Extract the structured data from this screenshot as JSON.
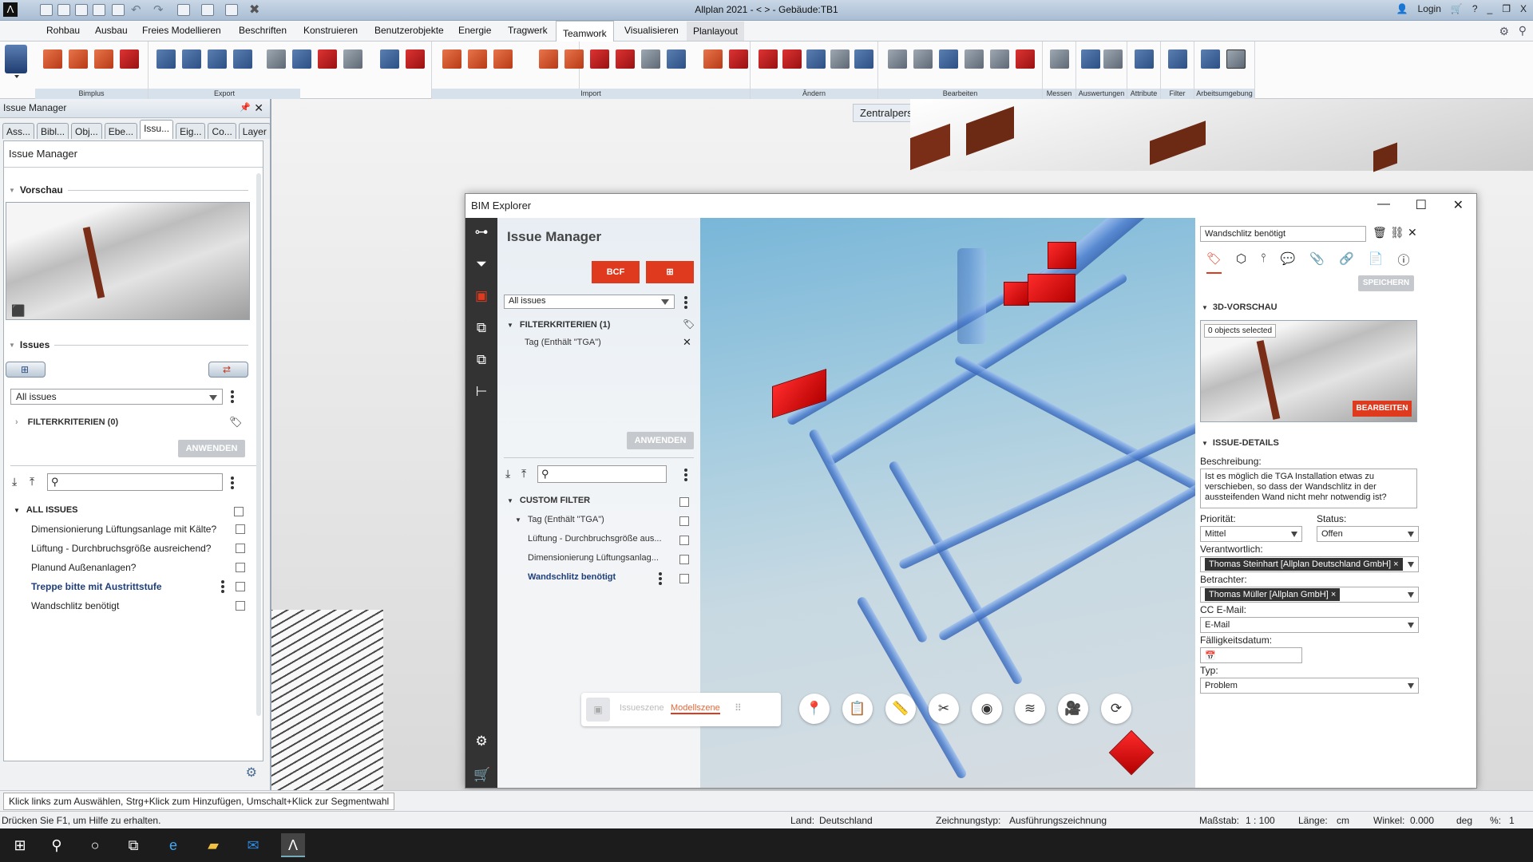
{
  "app": {
    "title": "Allplan 2021 - <    > - Gebäude:TB1",
    "login_label": "Login",
    "logo_glyph": "Λ"
  },
  "menu": {
    "tabs": [
      "Rohbau",
      "Ausbau",
      "Freies Modellieren",
      "Beschriften",
      "Konstruieren",
      "Benutzerobjekte",
      "Energie",
      "Tragwerk",
      "Teamwork",
      "Visualisieren",
      "Planlayout"
    ],
    "active_tab": "Teamwork"
  },
  "ribbon": {
    "groups": [
      "Bimplus",
      "Export",
      "Import",
      "Ändern",
      "Bearbeiten",
      "Messen",
      "Auswertungen",
      "Attribute",
      "Filter",
      "Arbeitsumgebung"
    ]
  },
  "viewport": {
    "perspective_label": "Zentralperspektive"
  },
  "left_panel": {
    "title": "Issue Manager",
    "tabs": [
      "Ass...",
      "Bibl...",
      "Obj...",
      "Ebe...",
      "Issu...",
      "Eig...",
      "Co...",
      "Layer"
    ],
    "active_tab": "Issu...",
    "header": "Issue Manager",
    "preview_label": "Vorschau",
    "issues_label": "Issues",
    "filter_select": "All issues",
    "filter_criteria": "FILTERKRITERIEN (0)",
    "apply_label": "ANWENDEN",
    "search_placeholder": "",
    "all_issues_label": "ALL ISSUES",
    "issues": [
      {
        "title": "Dimensionierung Lüftungsanlage mit Kälte?",
        "selected": false
      },
      {
        "title": "Lüftung - Durchbruchsgröße ausreichend?",
        "selected": false
      },
      {
        "title": "Planund Außenanlagen?",
        "selected": false
      },
      {
        "title": "Treppe bitte mit Austrittstufe",
        "selected": true
      },
      {
        "title": "Wandschlitz benötigt",
        "selected": false
      }
    ]
  },
  "bim_explorer": {
    "title": "BIM Explorer",
    "issue_manager": {
      "title": "Issue Manager",
      "bcf_label": "BCF",
      "filter_select": "All issues",
      "filter_criteria": "FILTERKRITERIEN (1)",
      "filter_tag": "Tag (Enthält \"TGA\")",
      "apply_label": "ANWENDEN",
      "custom_filter_label": "CUSTOM FILTER",
      "tag_group": "Tag (Enthält \"TGA\")",
      "issues": [
        {
          "title": "Lüftung - Durchbruchsgröße aus...",
          "selected": false
        },
        {
          "title": "Dimensionierung Lüftungsanlag...",
          "selected": false
        },
        {
          "title": "Wandschlitz benötigt",
          "selected": true
        }
      ]
    },
    "scene_toolbar": {
      "issue_scene": "Issueszene",
      "model_scene": "Modellszene"
    },
    "details": {
      "issue_title": "Wandschlitz benötigt",
      "save_label": "SPEICHERN",
      "preview_section": "3D-VORSCHAU",
      "objects_selected": "0 objects selected",
      "edit_label": "BEARBEITEN",
      "details_section": "ISSUE-DETAILS",
      "description_label": "Beschreibung:",
      "description": "Ist es möglich die TGA Installation etwas zu verschieben, so dass der Wandschlitz in der aussteifenden Wand nicht mehr notwendig ist?",
      "priority_label": "Priorität:",
      "priority": "Mittel",
      "status_label": "Status:",
      "status": "Offen",
      "responsible_label": "Verantwortlich:",
      "responsible": "Thomas Steinhart [Allplan Deutschland GmbH]",
      "viewers_label": "Betrachter:",
      "viewer": "Thomas Müller [Allplan GmbH]",
      "cc_label": "CC E-Mail:",
      "cc_placeholder": "E-Mail",
      "due_label": "Fälligkeitsdatum:",
      "type_label": "Typ:",
      "type": "Problem"
    }
  },
  "status": {
    "hint": "Klick links zum Auswählen, Strg+Klick zum Hinzufügen, Umschalt+Klick zur Segmentwahl",
    "help": "Drücken Sie F1, um Hilfe zu erhalten.",
    "land_label": "Land:",
    "land": "Deutschland",
    "drawing_type_label": "Zeichnungstyp:",
    "drawing_type": "Ausführungszeichnung",
    "scale_label": "Maßstab:",
    "scale": "1 : 100",
    "length_label": "Länge:",
    "length_unit": "cm",
    "angle_label": "Winkel:",
    "angle": "0.000",
    "angle_unit": "deg",
    "percent_label": "%:",
    "percent": "1"
  },
  "colors": {
    "accent_red": "#e03a1e",
    "issue_blue": "#1f3f7a"
  }
}
